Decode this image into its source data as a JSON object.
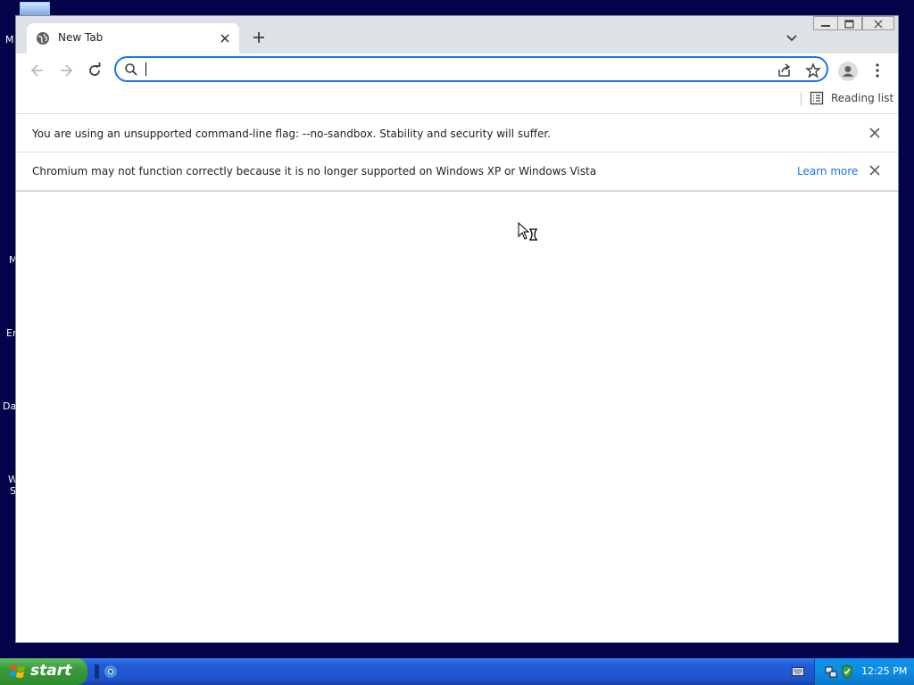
{
  "desktop": {
    "icon_label_fragments": [
      "M",
      "M",
      "Er",
      "Da",
      "W",
      "S"
    ]
  },
  "browser": {
    "tab": {
      "title": "New Tab"
    },
    "omnibox": {
      "value": "",
      "placeholder": ""
    },
    "bookmarks_bar": {
      "reading_list_label": "Reading list"
    },
    "infobars": [
      {
        "text": "You are using an unsupported command-line flag: --no-sandbox. Stability and security will suffer.",
        "link": ""
      },
      {
        "text": "Chromium may not function correctly because it is no longer supported on Windows XP or Windows Vista",
        "link": "Learn more"
      }
    ],
    "colors": {
      "accent": "#1a73e8",
      "titlebar": "#dee1e6"
    }
  },
  "taskbar": {
    "start_label": "start",
    "clock": "12:25 PM"
  }
}
